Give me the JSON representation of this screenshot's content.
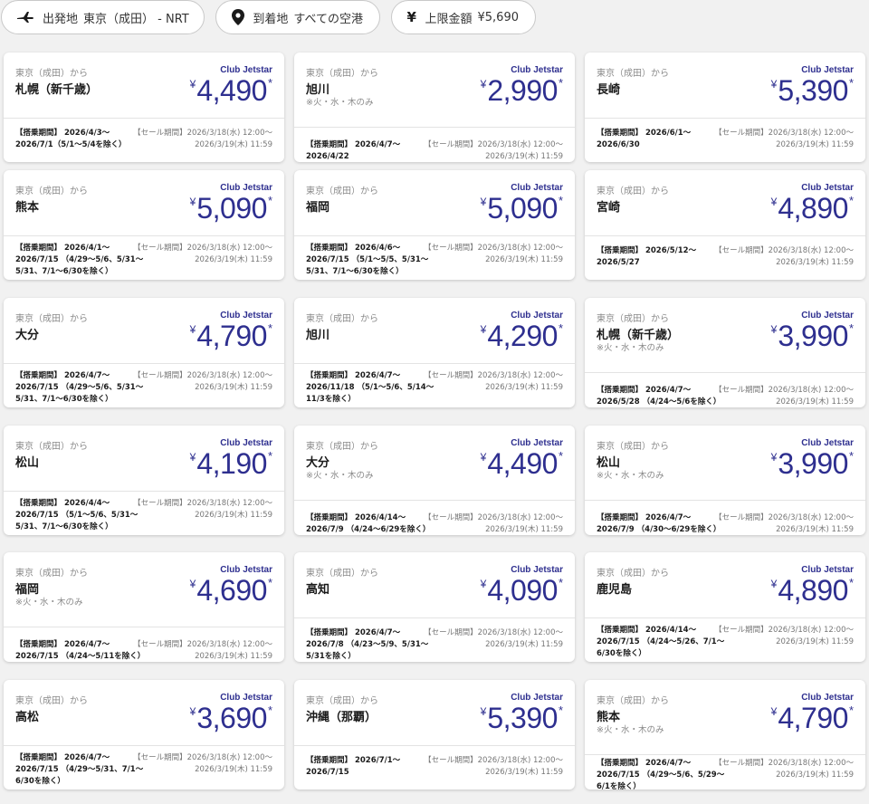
{
  "filters": {
    "origin": {
      "label": "出発地",
      "value": "東京（成田） - NRT",
      "icon": "airplane-icon"
    },
    "destination": {
      "label": "到着地",
      "value": "すべての空港",
      "icon": "location-pin-icon"
    },
    "price": {
      "label": "上限金額",
      "value": "¥5,690",
      "icon": "yen-icon"
    }
  },
  "colors": {
    "accent": "#2e2f8f",
    "muted": "#8a8a8a",
    "background": "#f1f1f1"
  },
  "cards": [
    {
      "from": "東京（成田）から",
      "city": "札幌（新千歳）",
      "note": "",
      "club": "Club Jetstar",
      "currency": "¥",
      "price": "4,490",
      "asterisk": "*",
      "period": "【搭乗期間】 2026/4/3〜2026/7/1（5/1〜5/4を除く）",
      "sale_label": "【セール期間】2026/3/18(水) 12:00〜",
      "sale_end": "2026/3/19(木) 11:59"
    },
    {
      "from": "東京（成田）から",
      "city": "旭川",
      "note": "※火・水・木のみ",
      "club": "Club Jetstar",
      "currency": "¥",
      "price": "2,990",
      "asterisk": "*",
      "period": "【搭乗期間】 2026/4/7〜2026/4/22",
      "sale_label": "【セール期間】2026/3/18(水) 12:00〜",
      "sale_end": "2026/3/19(木) 11:59"
    },
    {
      "from": "東京（成田）から",
      "city": "長崎",
      "note": "",
      "club": "Club Jetstar",
      "currency": "¥",
      "price": "5,390",
      "asterisk": "*",
      "period": "【搭乗期間】 2026/6/1〜2026/6/30",
      "sale_label": "【セール期間】2026/3/18(水) 12:00〜",
      "sale_end": "2026/3/19(木) 11:59"
    },
    {
      "from": "東京（成田）から",
      "city": "熊本",
      "note": "",
      "club": "Club Jetstar",
      "currency": "¥",
      "price": "5,090",
      "asterisk": "*",
      "period": "【搭乗期間】 2026/4/1〜2026/7/15 （4/29〜5/6、5/31〜5/31、7/1〜6/30を除く）",
      "sale_label": "【セール期間】2026/3/18(水) 12:00〜",
      "sale_end": "2026/3/19(木) 11:59"
    },
    {
      "from": "東京（成田）から",
      "city": "福岡",
      "note": "",
      "club": "Club Jetstar",
      "currency": "¥",
      "price": "5,090",
      "asterisk": "*",
      "period": "【搭乗期間】 2026/4/6〜2026/7/15 （5/1〜5/5、5/31〜5/31、7/1〜6/30を除く）",
      "sale_label": "【セール期間】2026/3/18(水) 12:00〜",
      "sale_end": "2026/3/19(木) 11:59"
    },
    {
      "from": "東京（成田）から",
      "city": "宮崎",
      "note": "",
      "club": "Club Jetstar",
      "currency": "¥",
      "price": "4,890",
      "asterisk": "*",
      "period": "【搭乗期間】 2026/5/12〜2026/5/27",
      "sale_label": "【セール期間】2026/3/18(水) 12:00〜",
      "sale_end": "2026/3/19(木) 11:59"
    },
    {
      "from": "東京（成田）から",
      "city": "大分",
      "note": "",
      "club": "Club Jetstar",
      "currency": "¥",
      "price": "4,790",
      "asterisk": "*",
      "period": "【搭乗期間】 2026/4/7〜2026/7/15 （4/29〜5/6、5/31〜5/31、7/1〜6/30を除く）",
      "sale_label": "【セール期間】2026/3/18(水) 12:00〜",
      "sale_end": "2026/3/19(木) 11:59"
    },
    {
      "from": "東京（成田）から",
      "city": "旭川",
      "note": "",
      "club": "Club Jetstar",
      "currency": "¥",
      "price": "4,290",
      "asterisk": "*",
      "period": "【搭乗期間】 2026/4/7〜2026/11/18 （5/1〜5/6、5/14〜11/3を除く）",
      "sale_label": "【セール期間】2026/3/18(水) 12:00〜",
      "sale_end": "2026/3/19(木) 11:59"
    },
    {
      "from": "東京（成田）から",
      "city": "札幌（新千歳）",
      "note": "※火・水・木のみ",
      "club": "Club Jetstar",
      "currency": "¥",
      "price": "3,990",
      "asterisk": "*",
      "period": "【搭乗期間】 2026/4/7〜2026/5/28 （4/24〜5/6を除く）",
      "sale_label": "【セール期間】2026/3/18(水) 12:00〜",
      "sale_end": "2026/3/19(木) 11:59"
    },
    {
      "from": "東京（成田）から",
      "city": "松山",
      "note": "",
      "club": "Club Jetstar",
      "currency": "¥",
      "price": "4,190",
      "asterisk": "*",
      "period": "【搭乗期間】 2026/4/4〜2026/7/15 （5/1〜5/6、5/31〜5/31、7/1〜6/30を除く）",
      "sale_label": "【セール期間】2026/3/18(水) 12:00〜",
      "sale_end": "2026/3/19(木) 11:59"
    },
    {
      "from": "東京（成田）から",
      "city": "大分",
      "note": "※火・水・木のみ",
      "club": "Club Jetstar",
      "currency": "¥",
      "price": "4,490",
      "asterisk": "*",
      "period": "【搭乗期間】 2026/4/14〜2026/7/9 （4/24〜6/29を除く）",
      "sale_label": "【セール期間】2026/3/18(水) 12:00〜",
      "sale_end": "2026/3/19(木) 11:59"
    },
    {
      "from": "東京（成田）から",
      "city": "松山",
      "note": "※火・水・木のみ",
      "club": "Club Jetstar",
      "currency": "¥",
      "price": "3,990",
      "asterisk": "*",
      "period": "【搭乗期間】 2026/4/7〜2026/7/9 （4/30〜6/29を除く）",
      "sale_label": "【セール期間】2026/3/18(水) 12:00〜",
      "sale_end": "2026/3/19(木) 11:59"
    },
    {
      "from": "東京（成田）から",
      "city": "福岡",
      "note": "※火・水・木のみ",
      "club": "Club Jetstar",
      "currency": "¥",
      "price": "4,690",
      "asterisk": "*",
      "period": "【搭乗期間】 2026/4/7〜2026/7/15 （4/24〜5/11を除く）",
      "sale_label": "【セール期間】2026/3/18(水) 12:00〜",
      "sale_end": "2026/3/19(木) 11:59"
    },
    {
      "from": "東京（成田）から",
      "city": "高知",
      "note": "",
      "club": "Club Jetstar",
      "currency": "¥",
      "price": "4,090",
      "asterisk": "*",
      "period": "【搭乗期間】 2026/4/7〜2026/7/8 （4/23〜5/9、5/31〜5/31を除く）",
      "sale_label": "【セール期間】2026/3/18(水) 12:00〜",
      "sale_end": "2026/3/19(木) 11:59"
    },
    {
      "from": "東京（成田）から",
      "city": "鹿児島",
      "note": "",
      "club": "Club Jetstar",
      "currency": "¥",
      "price": "4,890",
      "asterisk": "*",
      "period": "【搭乗期間】 2026/4/14〜2026/7/15 （4/24〜5/26、7/1〜6/30を除く）",
      "sale_label": "【セール期間】2026/3/18(水) 12:00〜",
      "sale_end": "2026/3/19(木) 11:59"
    },
    {
      "from": "東京（成田）から",
      "city": "高松",
      "note": "",
      "club": "Club Jetstar",
      "currency": "¥",
      "price": "3,690",
      "asterisk": "*",
      "period": "【搭乗期間】 2026/4/7〜2026/7/15 （4/29〜5/31、7/1〜6/30を除く）",
      "sale_label": "【セール期間】2026/3/18(水) 12:00〜",
      "sale_end": "2026/3/19(木) 11:59"
    },
    {
      "from": "東京（成田）から",
      "city": "沖縄（那覇）",
      "note": "",
      "club": "Club Jetstar",
      "currency": "¥",
      "price": "5,390",
      "asterisk": "*",
      "period": "【搭乗期間】 2026/7/1〜2026/7/15",
      "sale_label": "【セール期間】2026/3/18(水) 12:00〜",
      "sale_end": "2026/3/19(木) 11:59"
    },
    {
      "from": "東京（成田）から",
      "city": "熊本",
      "note": "※火・水・木のみ",
      "club": "Club Jetstar",
      "currency": "¥",
      "price": "4,790",
      "asterisk": "*",
      "period": "【搭乗期間】 2026/4/7〜2026/7/15 （4/29〜5/6、5/29〜6/1を除く）",
      "sale_label": "【セール期間】2026/3/18(水) 12:00〜",
      "sale_end": "2026/3/19(木) 11:59"
    }
  ]
}
